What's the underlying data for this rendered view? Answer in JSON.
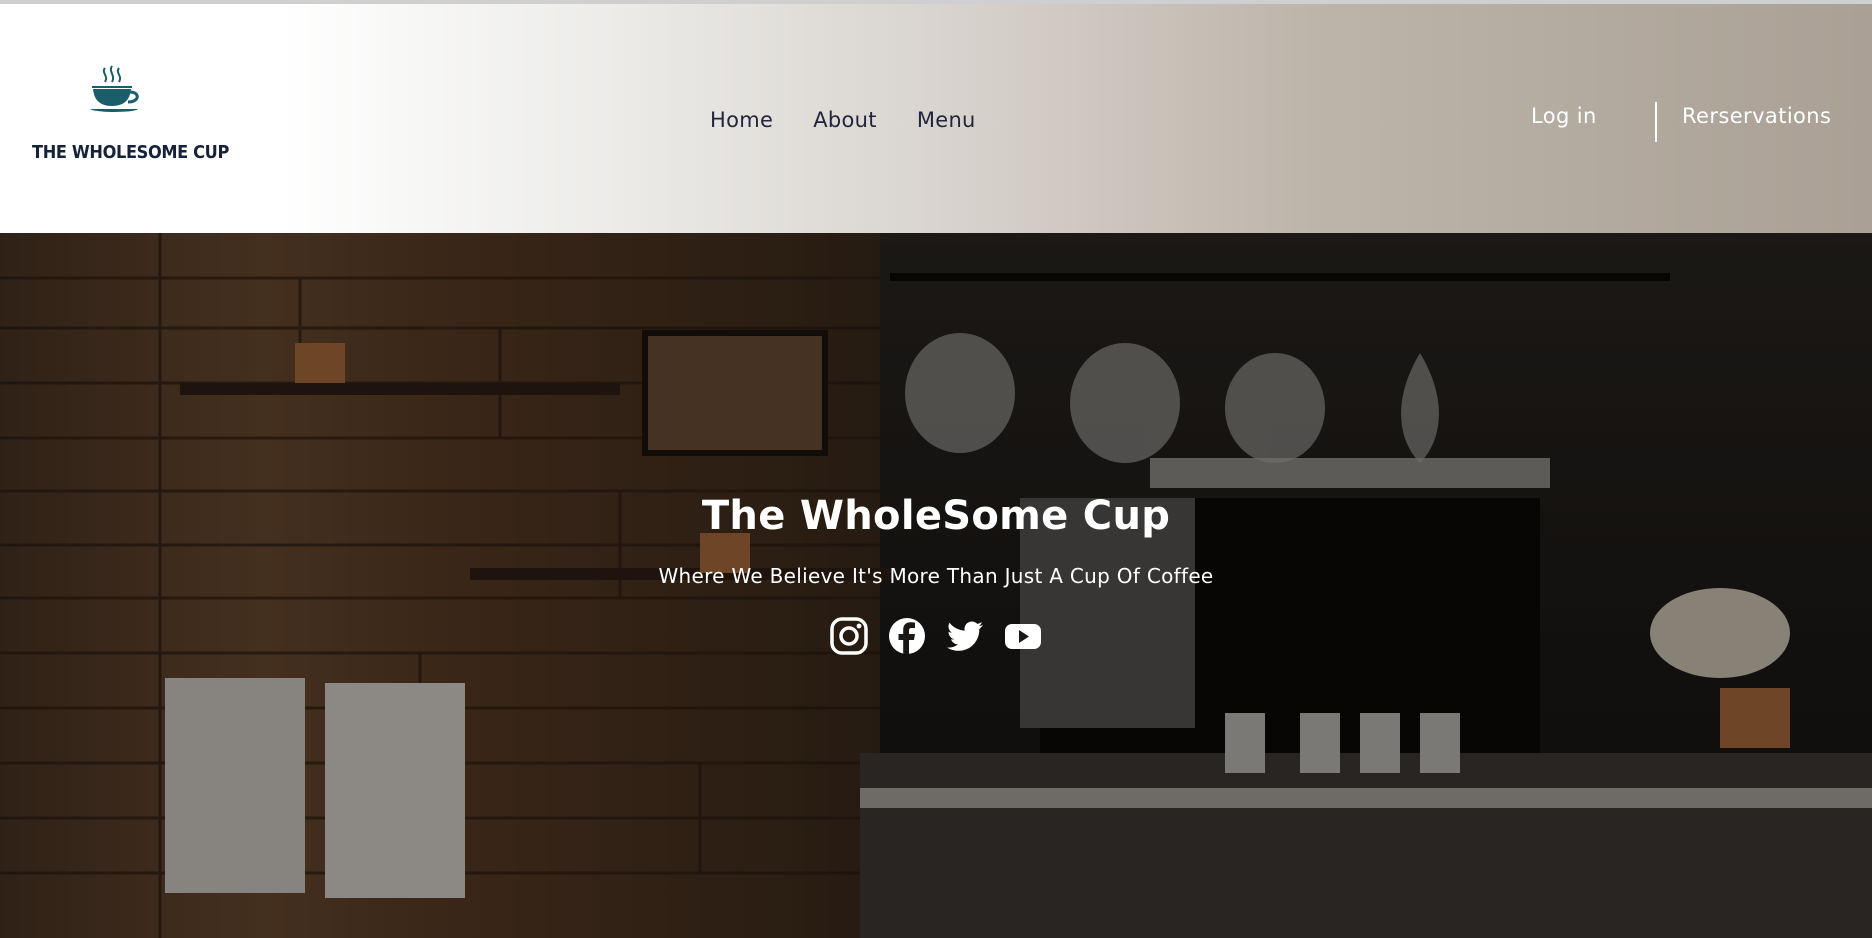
{
  "brand": {
    "name": "THE WHOLESOME CUP",
    "logo_icon": "coffee-cup-icon",
    "logo_color": "#1b5e6b"
  },
  "nav": {
    "items": [
      {
        "label": "Home"
      },
      {
        "label": "About"
      },
      {
        "label": "Menu"
      }
    ]
  },
  "auth": {
    "login_label": "Log in",
    "reservations_label": "Rerservations"
  },
  "hero": {
    "title": "The WholeSome Cup",
    "subtitle": "Where We Believe It's More Than Just A Cup Of Coffee",
    "background": "coffee-shop-interior-photo",
    "socials": [
      {
        "icon": "instagram-icon"
      },
      {
        "icon": "facebook-icon"
      },
      {
        "icon": "twitter-icon"
      },
      {
        "icon": "youtube-icon"
      }
    ]
  },
  "colors": {
    "nav_text": "#23253f",
    "header_gradient_end": "#aaa095",
    "hero_text": "#ffffff"
  }
}
